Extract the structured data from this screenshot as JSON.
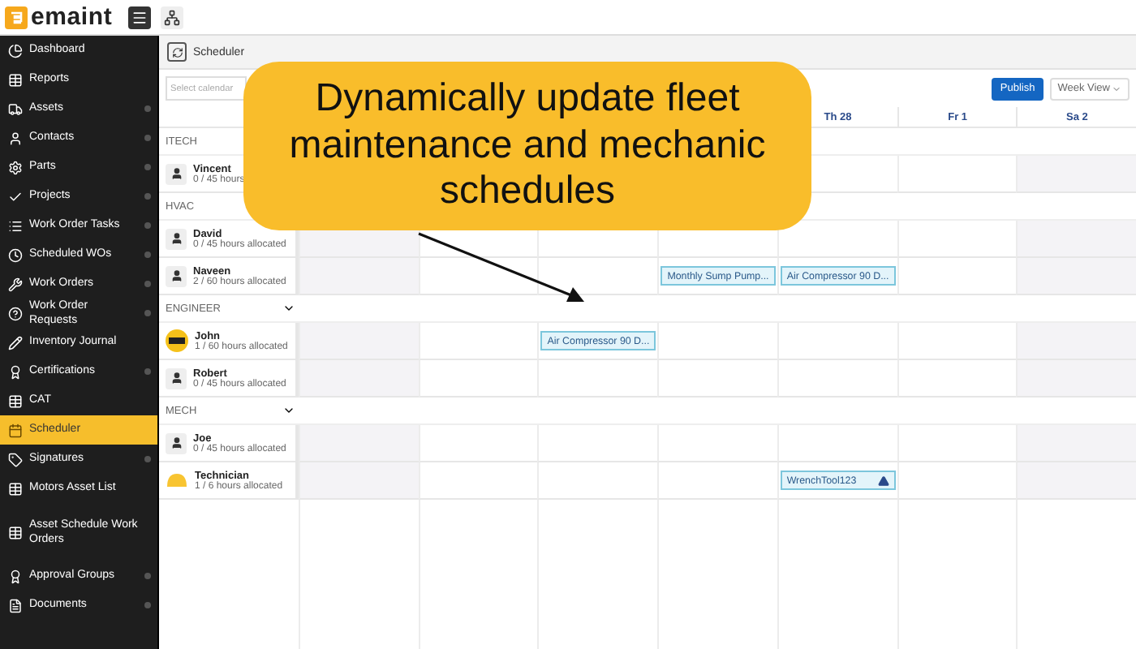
{
  "header": {
    "logo": "emaint"
  },
  "sidebar": {
    "items": [
      {
        "label": "Dashboard",
        "expandable": false,
        "selected": false
      },
      {
        "label": "Reports",
        "expandable": false,
        "selected": false
      },
      {
        "label": "Assets",
        "expandable": true,
        "selected": false
      },
      {
        "label": "Contacts",
        "expandable": true,
        "selected": false
      },
      {
        "label": "Parts",
        "expandable": true,
        "selected": false
      },
      {
        "label": "Projects",
        "expandable": true,
        "selected": false
      },
      {
        "label": "Work Order Tasks",
        "expandable": true,
        "selected": false
      },
      {
        "label": "Scheduled WOs",
        "expandable": true,
        "selected": false
      },
      {
        "label": "Work Orders",
        "expandable": true,
        "selected": false
      },
      {
        "label": "Work Order Requests",
        "expandable": true,
        "selected": false
      },
      {
        "label": "Inventory Journal",
        "expandable": false,
        "selected": false
      },
      {
        "label": "Certifications",
        "expandable": true,
        "selected": false
      },
      {
        "label": "CAT",
        "expandable": false,
        "selected": false
      },
      {
        "label": "Scheduler",
        "expandable": false,
        "selected": true
      },
      {
        "label": "Signatures",
        "expandable": true,
        "selected": false
      },
      {
        "label": "Motors Asset List",
        "expandable": false,
        "selected": false
      },
      {
        "label": "Asset Schedule Work Orders",
        "expandable": false,
        "selected": false
      },
      {
        "label": "Approval Groups",
        "expandable": true,
        "selected": false
      },
      {
        "label": "Documents",
        "expandable": true,
        "selected": false
      }
    ]
  },
  "breadcrumb": "Scheduler",
  "toolbar": {
    "calendar_select": {
      "placeholder": "Select calendar"
    },
    "publish": "Publish",
    "view": "Week View"
  },
  "day_headers": [
    "Th 28",
    "Fr 1",
    "Sa 2"
  ],
  "groups": [
    {
      "name": "ITECH",
      "people": [
        {
          "name": "Vincent",
          "hours": "0 / 45 hours",
          "kind": "generic"
        }
      ]
    },
    {
      "name": "HVAC",
      "people": [
        {
          "name": "David",
          "hours": "0 / 45 hours allocated",
          "kind": "generic"
        },
        {
          "name": "Naveen",
          "hours": "2 / 60 hours allocated",
          "kind": "generic",
          "events": [
            {
              "title": "Monthly Sump Pump...",
              "warning": false
            },
            {
              "title": "Air Compressor 90 D...",
              "warning": false
            }
          ]
        }
      ]
    },
    {
      "name": "ENGINEER",
      "expanded": true,
      "people": [
        {
          "name": "John",
          "hours": "1 / 60 hours allocated",
          "kind": "badge",
          "events": [
            {
              "title": "Air Compressor 90 D...",
              "warning": false
            }
          ]
        },
        {
          "name": "Robert",
          "hours": "0 / 45 hours allocated",
          "kind": "generic"
        }
      ]
    },
    {
      "name": "MECH",
      "expanded": true,
      "people": [
        {
          "name": "Joe",
          "hours": "0 / 45 hours allocated",
          "kind": "generic"
        },
        {
          "name": "Technician",
          "hours": "1 / 6 hours allocated",
          "kind": "hardhat",
          "events": [
            {
              "title": "WrenchTool123",
              "warning": true
            }
          ]
        }
      ]
    }
  ],
  "callout": {
    "text": "Dynamically update fleet maintenance and mechanic schedules"
  }
}
